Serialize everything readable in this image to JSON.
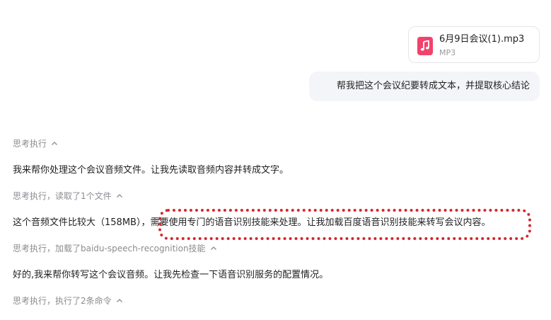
{
  "attachment": {
    "file_name": "6月9日会议(1).mp3",
    "file_type": "MP3",
    "icon": "music-note-icon",
    "icon_color": "#f2416b"
  },
  "user_message": {
    "text": "帮我把这个会议纪要转成文本，并提取核心结论"
  },
  "conversation": [
    {
      "kind": "header",
      "text": "思考执行"
    },
    {
      "kind": "text",
      "text": "我来帮你处理这个会议音频文件。让我先读取音频内容并转成文字。"
    },
    {
      "kind": "header",
      "text": "思考执行，读取了1个文件"
    },
    {
      "kind": "text",
      "text": "这个音频文件比较大（158MB），需要使用专门的语音识别技能来处理。让我加载百度语音识别技能来转写会议内容。"
    },
    {
      "kind": "header",
      "text": "思考执行，加载了baidu-speech-recognition技能"
    },
    {
      "kind": "text",
      "text": "好的,我来帮你转写这个会议音频。让我先检查一下语音识别服务的配置情况。"
    },
    {
      "kind": "header",
      "text": "思考执行，执行了2条命令"
    }
  ],
  "highlight_color": "#d6262b"
}
